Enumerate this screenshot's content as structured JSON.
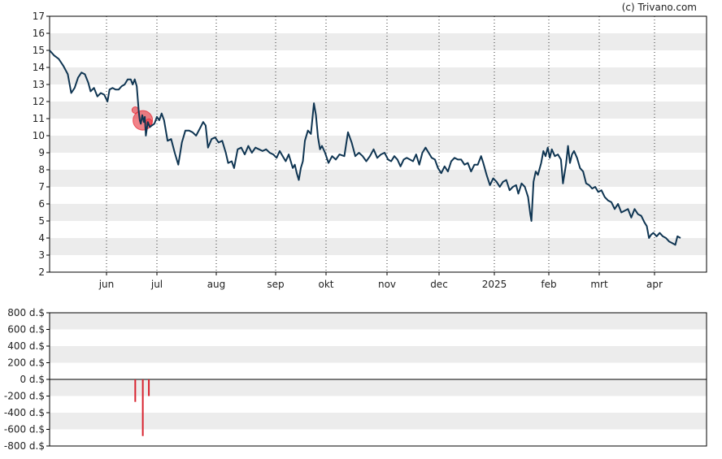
{
  "credit": "(c) Trivano.com",
  "colors": {
    "line": "#0f3552",
    "band": "#ececec",
    "marker": "#e8303a",
    "bar": "#d8232f",
    "axis": "#000000"
  },
  "chart_data": [
    {
      "type": "line",
      "title": "",
      "xlabel": "",
      "ylabel": "",
      "x_tick_labels": [
        "jun",
        "jul",
        "aug",
        "sep",
        "okt",
        "nov",
        "dec",
        "2025",
        "feb",
        "mrt",
        "apr"
      ],
      "y_tick_labels": [
        "2",
        "3",
        "4",
        "5",
        "6",
        "7",
        "8",
        "9",
        "10",
        "11",
        "12",
        "13",
        "14",
        "15",
        "16",
        "17"
      ],
      "ylim": [
        2,
        17
      ],
      "xlim_months": [
        0,
        12.0
      ],
      "grid": "vertical dotted lines at month starts, alternating horizontal bands",
      "series": [
        {
          "points": [
            [
              0.0,
              15.0
            ],
            [
              0.08,
              14.7
            ],
            [
              0.16,
              14.5
            ],
            [
              0.24,
              14.1
            ],
            [
              0.32,
              13.6
            ],
            [
              0.38,
              12.5
            ],
            [
              0.44,
              12.8
            ],
            [
              0.5,
              13.4
            ],
            [
              0.56,
              13.7
            ],
            [
              0.62,
              13.6
            ],
            [
              0.68,
              13.1
            ],
            [
              0.72,
              12.6
            ],
            [
              0.78,
              12.8
            ],
            [
              0.84,
              12.3
            ],
            [
              0.9,
              12.5
            ],
            [
              0.96,
              12.4
            ],
            [
              1.02,
              12.0
            ],
            [
              1.06,
              12.7
            ],
            [
              1.12,
              12.8
            ],
            [
              1.18,
              12.7
            ],
            [
              1.24,
              12.7
            ],
            [
              1.3,
              12.9
            ],
            [
              1.36,
              13.0
            ],
            [
              1.42,
              13.3
            ],
            [
              1.48,
              13.3
            ],
            [
              1.52,
              13.0
            ],
            [
              1.56,
              13.3
            ],
            [
              1.6,
              12.9
            ],
            [
              1.64,
              11.4
            ],
            [
              1.66,
              10.9
            ],
            [
              1.68,
              10.7
            ],
            [
              1.71,
              11.2
            ],
            [
              1.74,
              10.8
            ],
            [
              1.76,
              11.1
            ],
            [
              1.78,
              10.0
            ],
            [
              1.82,
              10.8
            ],
            [
              1.86,
              10.5
            ],
            [
              1.9,
              10.6
            ],
            [
              1.95,
              10.7
            ],
            [
              2.0,
              11.1
            ],
            [
              2.04,
              10.9
            ],
            [
              2.08,
              11.3
            ],
            [
              2.12,
              10.9
            ],
            [
              2.18,
              9.7
            ],
            [
              2.24,
              9.8
            ],
            [
              2.3,
              9.0
            ],
            [
              2.36,
              8.3
            ],
            [
              2.42,
              9.6
            ],
            [
              2.48,
              10.3
            ],
            [
              2.54,
              10.3
            ],
            [
              2.6,
              10.2
            ],
            [
              2.66,
              10.0
            ],
            [
              2.72,
              10.4
            ],
            [
              2.78,
              10.8
            ],
            [
              2.82,
              10.6
            ],
            [
              2.86,
              9.3
            ],
            [
              2.92,
              9.8
            ],
            [
              2.98,
              9.9
            ],
            [
              3.04,
              9.6
            ],
            [
              3.1,
              9.7
            ],
            [
              3.16,
              9.0
            ],
            [
              3.2,
              8.4
            ],
            [
              3.26,
              8.5
            ],
            [
              3.3,
              8.1
            ],
            [
              3.36,
              9.2
            ],
            [
              3.42,
              9.3
            ],
            [
              3.48,
              8.9
            ],
            [
              3.54,
              9.4
            ],
            [
              3.6,
              9.0
            ],
            [
              3.66,
              9.3
            ],
            [
              3.72,
              9.2
            ],
            [
              3.78,
              9.1
            ],
            [
              3.84,
              9.2
            ],
            [
              3.9,
              9.0
            ],
            [
              3.96,
              8.9
            ],
            [
              4.02,
              8.7
            ],
            [
              4.08,
              9.1
            ],
            [
              4.14,
              8.8
            ],
            [
              4.2,
              8.5
            ],
            [
              4.26,
              8.9
            ],
            [
              4.3,
              8.5
            ],
            [
              4.34,
              8.1
            ],
            [
              4.38,
              8.3
            ],
            [
              4.42,
              7.8
            ],
            [
              4.46,
              7.4
            ],
            [
              4.5,
              8.1
            ],
            [
              4.54,
              8.5
            ],
            [
              4.58,
              9.7
            ],
            [
              4.64,
              10.3
            ],
            [
              4.7,
              10.1
            ],
            [
              4.76,
              11.9
            ],
            [
              4.8,
              11.2
            ],
            [
              4.84,
              9.9
            ],
            [
              4.88,
              9.2
            ],
            [
              4.92,
              9.4
            ],
            [
              4.98,
              9.0
            ],
            [
              5.04,
              8.4
            ],
            [
              5.1,
              8.8
            ],
            [
              5.16,
              8.6
            ],
            [
              5.22,
              8.9
            ],
            [
              5.3,
              8.8
            ],
            [
              5.36,
              10.2
            ],
            [
              5.42,
              9.6
            ],
            [
              5.48,
              8.8
            ],
            [
              5.54,
              9.0
            ],
            [
              5.6,
              8.8
            ],
            [
              5.66,
              8.5
            ],
            [
              5.72,
              8.8
            ],
            [
              5.78,
              9.2
            ],
            [
              5.84,
              8.7
            ],
            [
              5.9,
              8.9
            ],
            [
              5.96,
              9.0
            ],
            [
              6.02,
              8.6
            ],
            [
              6.08,
              8.5
            ],
            [
              6.14,
              8.8
            ],
            [
              6.2,
              8.6
            ],
            [
              6.26,
              8.2
            ],
            [
              6.32,
              8.6
            ],
            [
              6.38,
              8.7
            ],
            [
              6.44,
              8.6
            ],
            [
              6.5,
              8.5
            ],
            [
              6.56,
              8.9
            ],
            [
              6.62,
              8.3
            ],
            [
              6.68,
              9.0
            ],
            [
              6.74,
              9.3
            ],
            [
              6.8,
              9.0
            ],
            [
              6.86,
              8.7
            ],
            [
              6.92,
              8.6
            ],
            [
              6.98,
              8.1
            ],
            [
              7.04,
              7.8
            ],
            [
              7.1,
              8.2
            ],
            [
              7.16,
              7.9
            ],
            [
              7.22,
              8.5
            ],
            [
              7.28,
              8.7
            ],
            [
              7.34,
              8.6
            ],
            [
              7.4,
              8.6
            ],
            [
              7.46,
              8.3
            ],
            [
              7.52,
              8.4
            ],
            [
              7.58,
              7.9
            ],
            [
              7.64,
              8.3
            ],
            [
              7.7,
              8.3
            ],
            [
              7.76,
              8.8
            ],
            [
              7.8,
              8.4
            ],
            [
              7.86,
              7.7
            ],
            [
              7.92,
              7.1
            ],
            [
              7.98,
              7.5
            ],
            [
              8.04,
              7.3
            ],
            [
              8.1,
              7.0
            ],
            [
              8.16,
              7.3
            ],
            [
              8.22,
              7.4
            ],
            [
              8.28,
              6.8
            ],
            [
              8.34,
              7.0
            ],
            [
              8.4,
              7.1
            ],
            [
              8.44,
              6.6
            ],
            [
              8.5,
              7.2
            ],
            [
              8.56,
              7.0
            ],
            [
              8.62,
              6.4
            ],
            [
              8.66,
              5.4
            ],
            [
              8.68,
              5.0
            ],
            [
              8.72,
              7.3
            ],
            [
              8.76,
              7.9
            ],
            [
              8.8,
              7.7
            ],
            [
              8.86,
              8.4
            ],
            [
              8.9,
              9.1
            ],
            [
              8.94,
              8.8
            ],
            [
              8.98,
              9.3
            ],
            [
              9.02,
              8.7
            ],
            [
              9.06,
              9.2
            ],
            [
              9.12,
              8.8
            ],
            [
              9.18,
              8.9
            ],
            [
              9.24,
              8.6
            ],
            [
              9.28,
              7.2
            ],
            [
              9.34,
              8.3
            ],
            [
              9.38,
              9.4
            ],
            [
              9.42,
              8.4
            ],
            [
              9.46,
              8.9
            ],
            [
              9.5,
              9.1
            ],
            [
              9.56,
              8.7
            ],
            [
              9.62,
              8.1
            ],
            [
              9.68,
              7.9
            ],
            [
              9.74,
              7.2
            ],
            [
              9.8,
              7.1
            ],
            [
              9.86,
              6.9
            ],
            [
              9.92,
              7.0
            ],
            [
              9.98,
              6.7
            ],
            [
              10.04,
              6.8
            ],
            [
              10.1,
              6.4
            ],
            [
              10.16,
              6.2
            ],
            [
              10.22,
              6.1
            ],
            [
              10.28,
              5.7
            ],
            [
              10.34,
              6.0
            ],
            [
              10.4,
              5.5
            ],
            [
              10.46,
              5.6
            ],
            [
              10.52,
              5.7
            ],
            [
              10.58,
              5.2
            ],
            [
              10.64,
              5.7
            ],
            [
              10.7,
              5.4
            ],
            [
              10.76,
              5.3
            ],
            [
              10.82,
              4.9
            ],
            [
              10.86,
              4.7
            ],
            [
              10.9,
              4.0
            ],
            [
              10.94,
              4.2
            ],
            [
              10.98,
              4.3
            ],
            [
              11.04,
              4.1
            ],
            [
              11.1,
              4.3
            ],
            [
              11.16,
              4.1
            ],
            [
              11.22,
              4.0
            ],
            [
              11.28,
              3.8
            ],
            [
              11.34,
              3.7
            ],
            [
              11.4,
              3.6
            ],
            [
              11.44,
              4.1
            ],
            [
              11.5,
              4.0
            ]
          ]
        }
      ],
      "markers": [
        {
          "month": 1.57,
          "value": 11.5,
          "size": "small"
        },
        {
          "month": 1.72,
          "value": 10.9,
          "size": "large"
        },
        {
          "month": 1.84,
          "value": 10.8,
          "size": "small"
        }
      ]
    },
    {
      "type": "bar",
      "title": "",
      "xlabel": "",
      "ylabel": "",
      "y_tick_labels": [
        "800 d.$",
        "600 d.$",
        "400 d.$",
        "200 d.$",
        "0 d.$",
        "-200 d.$",
        "-400 d.$",
        "-600 d.$",
        "-800 d.$"
      ],
      "ylim": [
        -800,
        800
      ],
      "grid": "alternating horizontal bands",
      "bars": [
        {
          "month": 1.57,
          "value": -270
        },
        {
          "month": 1.72,
          "value": -680
        },
        {
          "month": 1.84,
          "value": -200
        }
      ]
    }
  ]
}
